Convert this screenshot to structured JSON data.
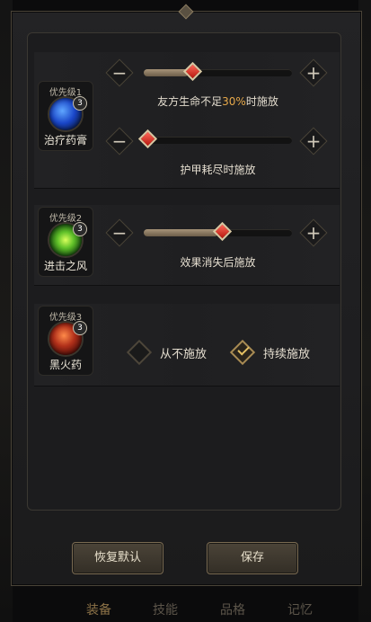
{
  "rules": [
    {
      "priority_label": "优先级1",
      "skill_name": "治疗药膏",
      "skill_icon": "healing-salve-icon",
      "stack_count": "3",
      "sliders": [
        {
          "caption_prefix": "友方生命不足",
          "caption_value": "30%",
          "caption_suffix": "时施放",
          "fill_fraction": 0.3
        },
        {
          "caption": "护甲耗尽时施放",
          "fill_fraction": 0.0
        }
      ]
    },
    {
      "priority_label": "优先级2",
      "skill_name": "进击之风",
      "skill_icon": "wind-advance-icon",
      "stack_count": "3",
      "sliders": [
        {
          "caption": "效果消失后施放",
          "fill_fraction": 0.5
        }
      ]
    },
    {
      "priority_label": "优先级3",
      "skill_name": "黑火药",
      "skill_icon": "black-powder-icon",
      "stack_count": "3",
      "options": [
        {
          "label": "从不施放",
          "checked": false
        },
        {
          "label": "持续施放",
          "checked": true
        }
      ]
    }
  ],
  "buttons": {
    "reset": "恢复默认",
    "save": "保存"
  },
  "nav": [
    "装备",
    "技能",
    "品格",
    "记忆"
  ],
  "nav_active_index": 0,
  "colors": {
    "accent": "#e6a84a",
    "knob": "#d02a1c",
    "check": "#e6c163"
  }
}
